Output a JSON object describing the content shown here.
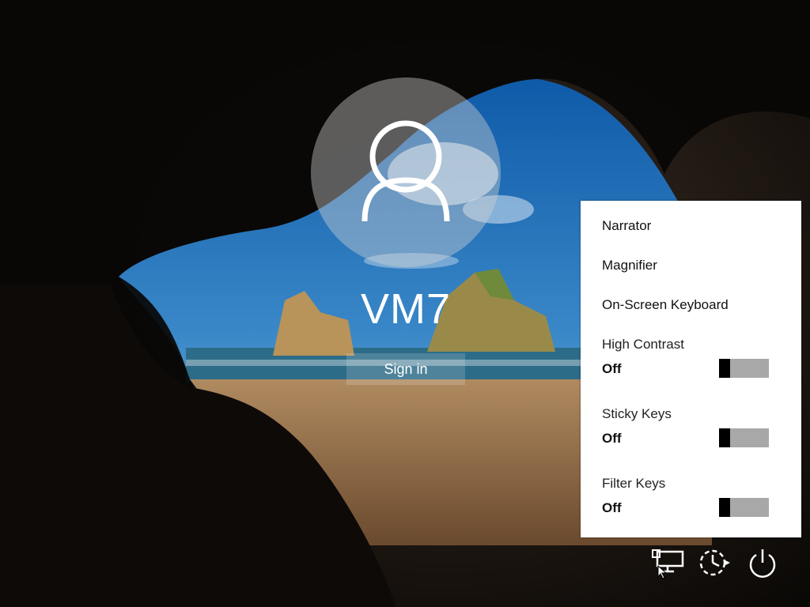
{
  "user": {
    "name": "VM7",
    "avatar_icon": "user-silhouette-icon"
  },
  "signin": {
    "label": "Sign in"
  },
  "ease_menu": {
    "items": [
      "Narrator",
      "Magnifier",
      "On-Screen Keyboard"
    ],
    "toggles": [
      {
        "label": "High Contrast",
        "state": "Off",
        "on": false
      },
      {
        "label": "Sticky Keys",
        "state": "Off",
        "on": false
      },
      {
        "label": "Filter Keys",
        "state": "Off",
        "on": false
      }
    ]
  },
  "taskbar": {
    "icons": [
      "network-icon",
      "ease-of-access-icon",
      "power-icon"
    ]
  },
  "colors": {
    "panel_bg": "#ffffff",
    "toggle_off": "#a8a8a8",
    "knob": "#000000"
  }
}
